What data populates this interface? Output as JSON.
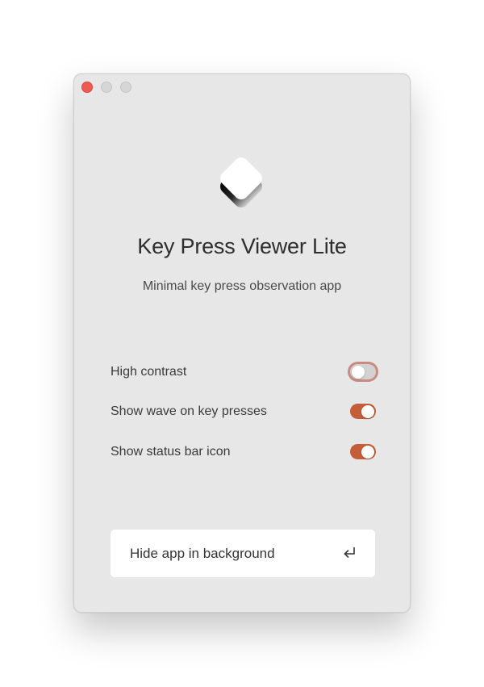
{
  "window": {
    "controls": {
      "close": "close-icon",
      "minimize": "minimize-icon",
      "maximize": "maximize-icon"
    },
    "app_icon": "key-diamond-icon",
    "title": "Key Press Viewer Lite",
    "subtitle": "Minimal key press observation app"
  },
  "settings": [
    {
      "label": "High contrast",
      "enabled": false
    },
    {
      "label": "Show wave on key presses",
      "enabled": true
    },
    {
      "label": "Show status bar icon",
      "enabled": true
    }
  ],
  "action_button": {
    "label": "Hide app in background",
    "icon": "return-icon"
  },
  "colors": {
    "accent": "#c45e39",
    "close_button": "#ee5b52",
    "window_background": "#e7e7e7"
  }
}
